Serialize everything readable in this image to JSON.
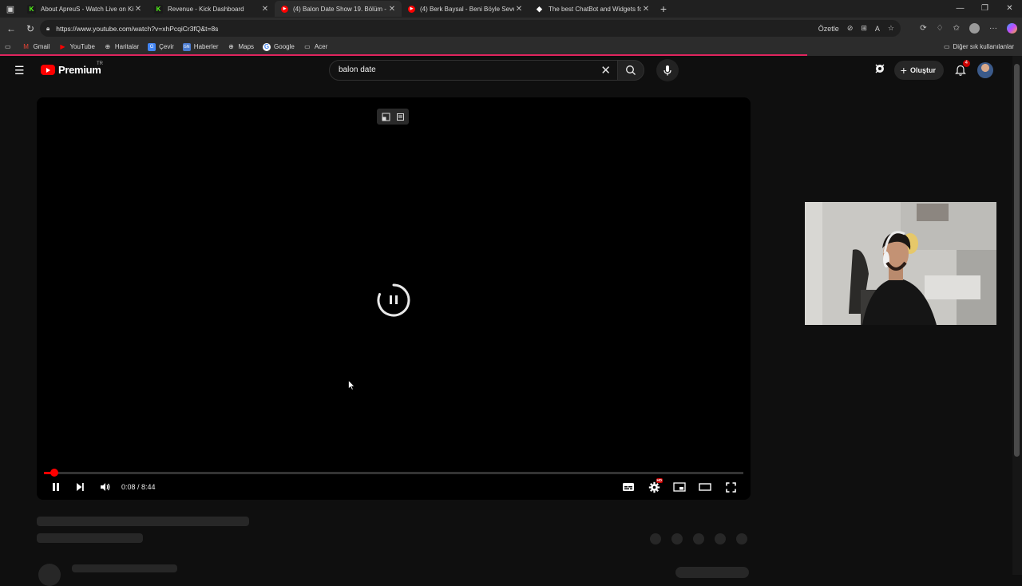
{
  "browser": {
    "tabs": [
      {
        "title": "About ApreuS - Watch Live on Ki",
        "icon": "kick-icon",
        "active": false
      },
      {
        "title": "Revenue - Kick Dashboard",
        "icon": "kick-icon",
        "active": false
      },
      {
        "title": "(4) Balon Date Show 19. Bölüm -",
        "icon": "youtube-icon",
        "active": true
      },
      {
        "title": "(4) Berk Baysal - Beni Böyle Sever",
        "icon": "youtube-icon",
        "active": false
      },
      {
        "title": "The best ChatBot and Widgets fo",
        "icon": "chatbot-icon",
        "active": false
      }
    ],
    "url": "https://www.youtube.com/watch?v=xhPcqiCr3fQ&t=8s",
    "summarize_label": "Özetle",
    "bookmarks": [
      {
        "label": "Gmail",
        "icon": "gmail-icon"
      },
      {
        "label": "YouTube",
        "icon": "youtube-icon"
      },
      {
        "label": "Haritalar",
        "icon": "globe-icon"
      },
      {
        "label": "Çevir",
        "icon": "translate-icon"
      },
      {
        "label": "Haberler",
        "icon": "news-icon"
      },
      {
        "label": "Maps",
        "icon": "globe-icon"
      },
      {
        "label": "Google",
        "icon": "google-icon"
      },
      {
        "label": "Acer",
        "icon": "folder-icon"
      }
    ],
    "other_bookmarks": "Diğer sık kullanılanlar",
    "page_load_progress": 0.79
  },
  "youtube": {
    "logo_text": "Premium",
    "region": "TR",
    "search_value": "balon date",
    "create_label": "Oluştur",
    "notification_count": "4",
    "player": {
      "time_current": "0:08",
      "time_separator": " / ",
      "time_total": "8:44",
      "progress_fraction": 0.0152
    }
  },
  "colors": {
    "accent_red": "#ff0000",
    "background": "#0f0f0f",
    "loading_bar": "#e0245e"
  }
}
